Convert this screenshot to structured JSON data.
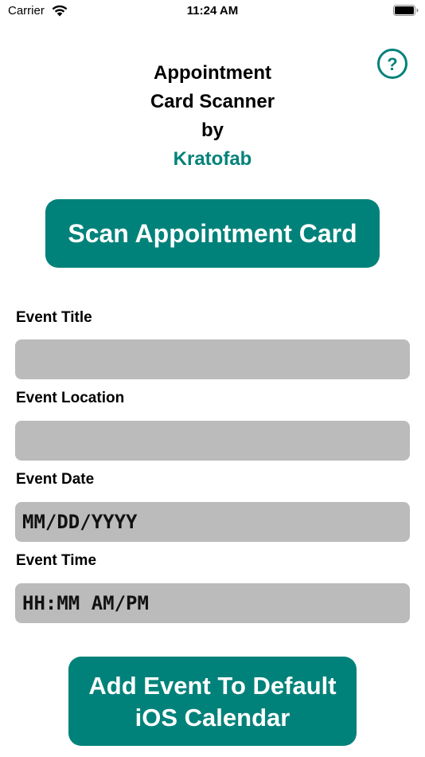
{
  "status_bar": {
    "carrier": "Carrier",
    "time": "11:24 AM",
    "wifi_icon": "wifi-icon",
    "battery_icon": "battery-icon"
  },
  "help": {
    "icon": "question-circle-icon",
    "glyph": "?"
  },
  "header": {
    "title_line_1": "Appointment",
    "title_line_2": "Card Scanner",
    "title_line_3": "by",
    "brand": "Kratofab"
  },
  "scan_button": {
    "label": "Scan Appointment Card"
  },
  "fields": {
    "title": {
      "label": "Event Title",
      "value": "",
      "placeholder": ""
    },
    "location": {
      "label": "Event Location",
      "value": "",
      "placeholder": ""
    },
    "date": {
      "label": "Event Date",
      "value": "",
      "placeholder": "MM/DD/YYYY"
    },
    "time": {
      "label": "Event Time",
      "value": "",
      "placeholder": "HH:MM AM/PM"
    }
  },
  "add_button": {
    "line_1": "Add Event To Default",
    "line_2": "iOS Calendar"
  },
  "colors": {
    "accent": "#00827a",
    "input_background": "#bbbbbb",
    "background": "#ffffff"
  }
}
